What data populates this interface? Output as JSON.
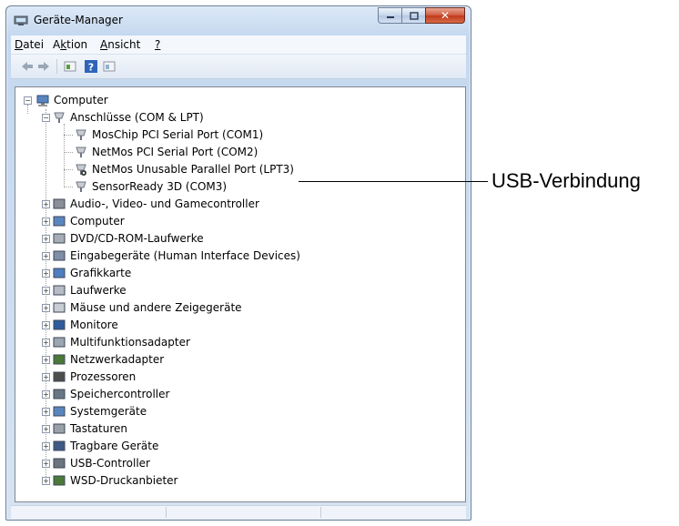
{
  "window": {
    "title": "Geräte-Manager"
  },
  "menu": [
    {
      "label": "Datei",
      "mnemonic": "D"
    },
    {
      "label": "Aktion",
      "mnemonic": "k"
    },
    {
      "label": "Ansicht",
      "mnemonic": "A"
    },
    {
      "label": "?",
      "mnemonic": "?"
    }
  ],
  "toolbar": {
    "back_icon": "arrow-left-icon",
    "forward_icon": "arrow-right-icon",
    "properties_icon": "properties-icon",
    "help_icon": "help-icon",
    "view_icon": "view-icon"
  },
  "tree": {
    "root": "Computer",
    "ports_group": "Anschlüsse (COM & LPT)",
    "ports": [
      "MosChip PCI Serial Port (COM1)",
      "NetMos PCI Serial Port (COM2)",
      "NetMos Unusable Parallel Port (LPT3)",
      "SensorReady 3D (COM3)"
    ],
    "categories": [
      "Audio-, Video- und Gamecontroller",
      "Computer",
      "DVD/CD-ROM-Laufwerke",
      "Eingabegeräte (Human Interface Devices)",
      "Grafikkarte",
      "Laufwerke",
      "Mäuse und andere Zeigegeräte",
      "Monitore",
      "Multifunktionsadapter",
      "Netzwerkadapter",
      "Prozessoren",
      "Speichercontroller",
      "Systemgeräte",
      "Tastaturen",
      "Tragbare Geräte",
      "USB-Controller",
      "WSD-Druckanbieter"
    ]
  },
  "callout": {
    "label": "USB-Verbindung"
  },
  "colors": {
    "title_bar": "#c5d8ef",
    "close_button": "#cf5a3e",
    "tree_bg": "#ffffff"
  }
}
